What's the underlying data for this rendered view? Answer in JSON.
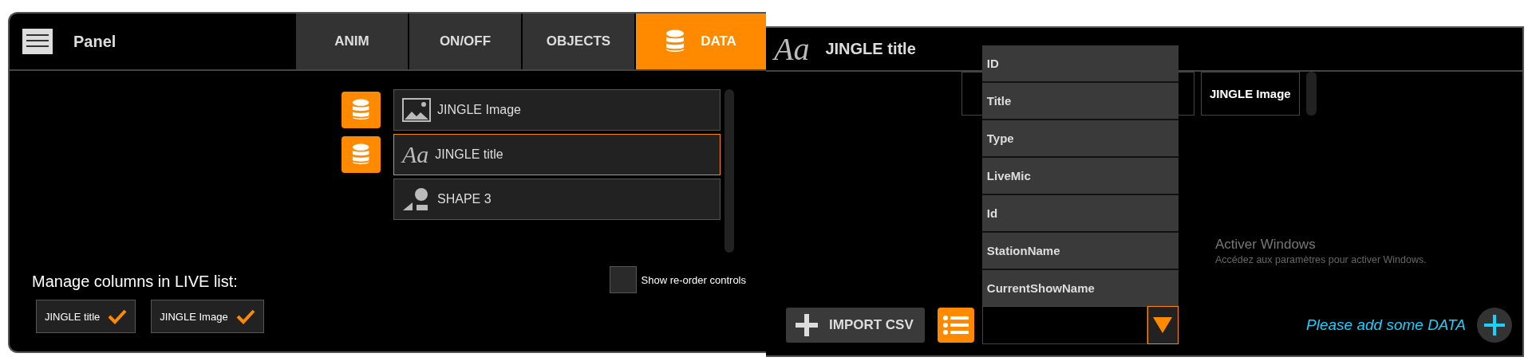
{
  "panel": {
    "title": "Panel"
  },
  "tabs": [
    {
      "label": "ANIM",
      "selected": false,
      "has_icon": false
    },
    {
      "label": "ON/OFF",
      "selected": false,
      "has_icon": false
    },
    {
      "label": "OBJECTS",
      "selected": false,
      "has_icon": false
    },
    {
      "label": "DATA",
      "selected": true,
      "has_icon": true
    }
  ],
  "objects": [
    {
      "name": "JINGLE Image",
      "kind": "image",
      "data_linked": true,
      "selected": false
    },
    {
      "name": "JINGLE title",
      "kind": "text",
      "glyph": "Aa",
      "data_linked": true,
      "selected": true
    },
    {
      "name": "SHAPE 3",
      "kind": "shape",
      "data_linked": false,
      "selected": false
    }
  ],
  "live_columns": {
    "heading": "Manage columns in LIVE list:",
    "items": [
      {
        "label": "JINGLE title",
        "checked": true
      },
      {
        "label": "JINGLE Image",
        "checked": true
      }
    ]
  },
  "reorder_option": {
    "label": "Show re-order controls",
    "checked": false
  },
  "data_panel": {
    "glyph": "Aa",
    "title": "JINGLE title",
    "columns": [
      "JINGLE Image"
    ],
    "dropdown": {
      "expanded": true,
      "options": [
        "ID",
        "Title",
        "Type",
        "LiveMic",
        "Id",
        "StationName",
        "CurrentShowName"
      ]
    },
    "import_button": "IMPORT CSV",
    "empty_message": "Please add some DATA",
    "windows_notice": {
      "title": "Activer Windows",
      "text": "Accédez aux paramètres pour activer Windows."
    }
  }
}
